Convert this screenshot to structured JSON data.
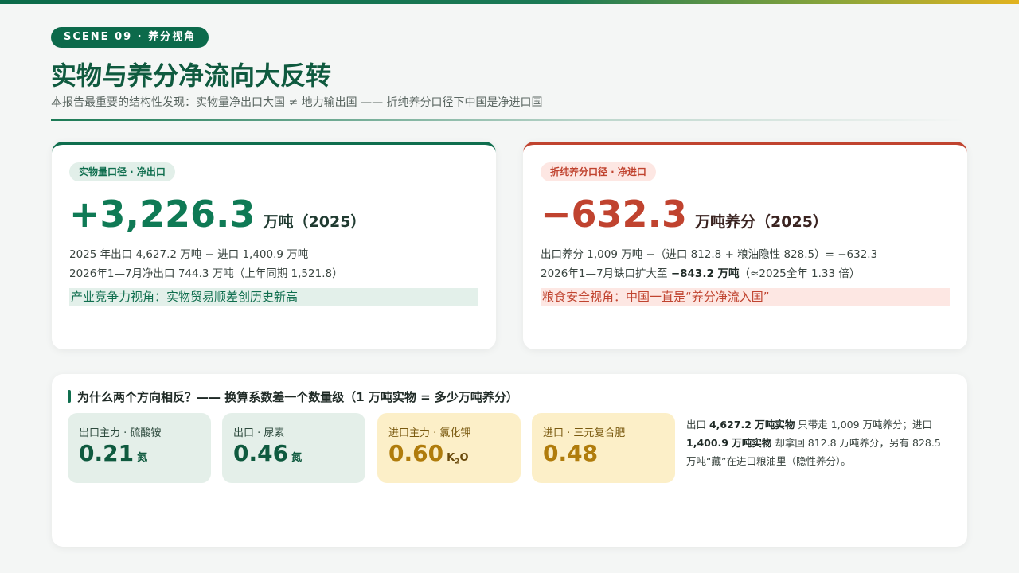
{
  "scene_label": "SCENE 09 · 养分视角",
  "title": "实物与养分净流向大反转",
  "subtitle": "本报告最重要的结构性发现：实物量净出口大国 ≠ 地力输出国 —— 折纯养分口径下中国是净进口国",
  "left_card": {
    "tag": "实物量口径 · 净出口",
    "value": "+3,226.3",
    "unit": "万吨（2025）",
    "line1": "2025 年出口 4,627.2 万吨 − 进口 1,400.9 万吨",
    "line2": "2026年1—7月净出口 744.3 万吨（上年同期 1,521.8）",
    "highlight": "产业竞争力视角：实物贸易顺差创历史新高"
  },
  "right_card": {
    "tag": "折纯养分口径 · 净进口",
    "value": "−632.3",
    "unit": "万吨养分（2025）",
    "line1": "出口养分 1,009 万吨 −（进口 812.8 + 粮油隐性 828.5）= −632.3",
    "line2_pre": "2026年1—7月缺口扩大至 ",
    "line2_bold": "−843.2 万吨",
    "line2_post": "（≈2025全年 1.33 倍）",
    "highlight": "粮食安全视角：中国一直是“养分净流入国”"
  },
  "bottom": {
    "section_title": "为什么两个方向相反？—— 换算系数差一个数量级（1 万吨实物 = 多少万吨养分）",
    "coefficients": [
      {
        "label": "出口主力 · 硫酸铵",
        "value": "0.21",
        "unit": "氮",
        "tone": "green"
      },
      {
        "label": "出口 · 尿素",
        "value": "0.46",
        "unit": "氮",
        "tone": "green"
      },
      {
        "label": "进口主力 · 氯化钾",
        "value": "0.60",
        "unit_main": "K",
        "unit_sub": "2",
        "unit_tail": "O",
        "tone": "yellow"
      },
      {
        "label": "进口 · 三元复合肥",
        "value": "0.48",
        "unit": "",
        "tone": "yellow"
      }
    ],
    "note": {
      "p1": "出口 ",
      "b1": "4,627.2 万吨实物",
      "p2": " 只带走 1,009 万吨养分；进口 ",
      "b2": "1,400.9 万吨实物",
      "p3": " 却拿回 812.8 万吨养分，另有 828.5 万吨“藏”在进口粮油里（隐性养分）。"
    }
  }
}
